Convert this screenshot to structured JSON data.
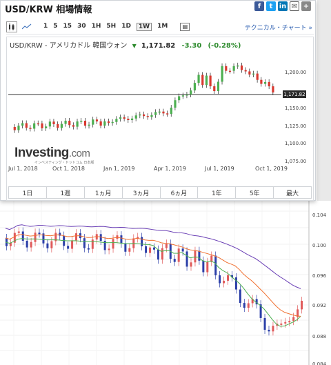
{
  "header": {
    "title": "USD/KRW 相場情報",
    "share": {
      "facebook": "f",
      "twitter": "t",
      "linkedin": "in",
      "mail": "✉",
      "plus": "+"
    }
  },
  "toolbar": {
    "timeframes": [
      "1",
      "5",
      "15",
      "30",
      "1H",
      "5H",
      "1D",
      "1W",
      "1M"
    ],
    "active": "1W",
    "technical_link": "テクニカル・チャート »"
  },
  "chart": {
    "pair_name": "USD/KRW - アメリカドル 韓国ウォン",
    "price": "1,171.82",
    "change": "-3.30",
    "change_pct": "(-0.28%)",
    "price_tag": "1,171.82",
    "logo_main": "Investing",
    "logo_domain": ".com",
    "logo_sub": "インベスティング・ドットコム 日本版",
    "x_labels": [
      "Jul 1, 2018",
      "Oct 1, 2018",
      "Jan 1, 2019",
      "Apr 1, 2019",
      "Jul 1, 2019",
      "Oct 1, 2019"
    ],
    "y_labels": [
      "1,200.00",
      "1,150.00",
      "1,125.00",
      "1,100.00",
      "1,075.00"
    ],
    "periods": [
      "1日",
      "1週",
      "1ヵ月",
      "3ヵ月",
      "6ヵ月",
      "1年",
      "5年",
      "最大"
    ]
  },
  "background_chart": {
    "y_labels": [
      "0.104",
      "0.100",
      "0.096",
      "0.092",
      "0.088",
      "0.084"
    ],
    "colors": {
      "up": "#e05a5a",
      "down": "#2b3fa8",
      "ma_short": "#4caf50",
      "ma_mid": "#f07030",
      "ma_long": "#6a3fb5"
    }
  }
}
